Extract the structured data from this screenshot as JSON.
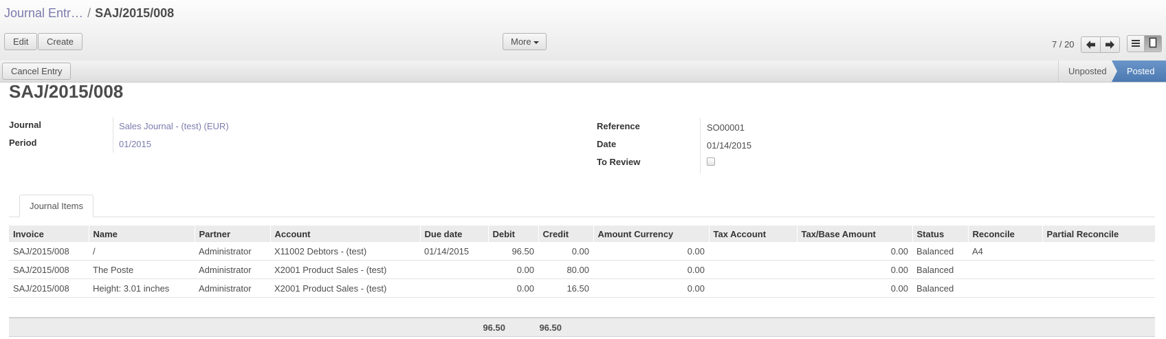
{
  "breadcrumb": {
    "parent": "Journal Entr…",
    "separator": "/",
    "current": "SAJ/2015/008"
  },
  "toolbar": {
    "edit": "Edit",
    "create": "Create",
    "more": "More"
  },
  "pager": {
    "text": "7 / 20"
  },
  "actions": {
    "cancel_entry": "Cancel Entry"
  },
  "status": {
    "stages": [
      "Unposted",
      "Posted"
    ],
    "active": "Posted",
    "active_color": "#5a87be"
  },
  "record": {
    "title": "SAJ/2015/008",
    "journal_label": "Journal",
    "journal_value": "Sales Journal - (test) (EUR)",
    "period_label": "Period",
    "period_value": "01/2015",
    "reference_label": "Reference",
    "reference_value": "SO00001",
    "date_label": "Date",
    "date_value": "01/14/2015",
    "review_label": "To Review",
    "review_checked": false
  },
  "tabs": {
    "journal_items": "Journal Items"
  },
  "table": {
    "columns": [
      "Invoice",
      "Name",
      "Partner",
      "Account",
      "Due date",
      "Debit",
      "Credit",
      "Amount Currency",
      "Tax Account",
      "Tax/Base Amount",
      "Status",
      "Reconcile",
      "Partial Reconcile"
    ],
    "rows": [
      [
        "SAJ/2015/008",
        "/",
        "Administrator",
        "X11002 Debtors - (test)",
        "01/14/2015",
        "96.50",
        "0.00",
        "0.00",
        "",
        "0.00",
        "Balanced",
        "A4",
        ""
      ],
      [
        "SAJ/2015/008",
        "The Poste",
        "Administrator",
        "X2001 Product Sales - (test)",
        "",
        "0.00",
        "80.00",
        "0.00",
        "",
        "0.00",
        "Balanced",
        "",
        ""
      ],
      [
        "SAJ/2015/008",
        "Height: 3.01 inches",
        "Administrator",
        "X2001 Product Sales - (test)",
        "",
        "0.00",
        "16.50",
        "0.00",
        "",
        "0.00",
        "Balanced",
        "",
        ""
      ]
    ],
    "totals": {
      "debit": "96.50",
      "credit": "96.50"
    }
  },
  "colors": {
    "link": "#7c7bad",
    "accent": "#5a87be"
  }
}
